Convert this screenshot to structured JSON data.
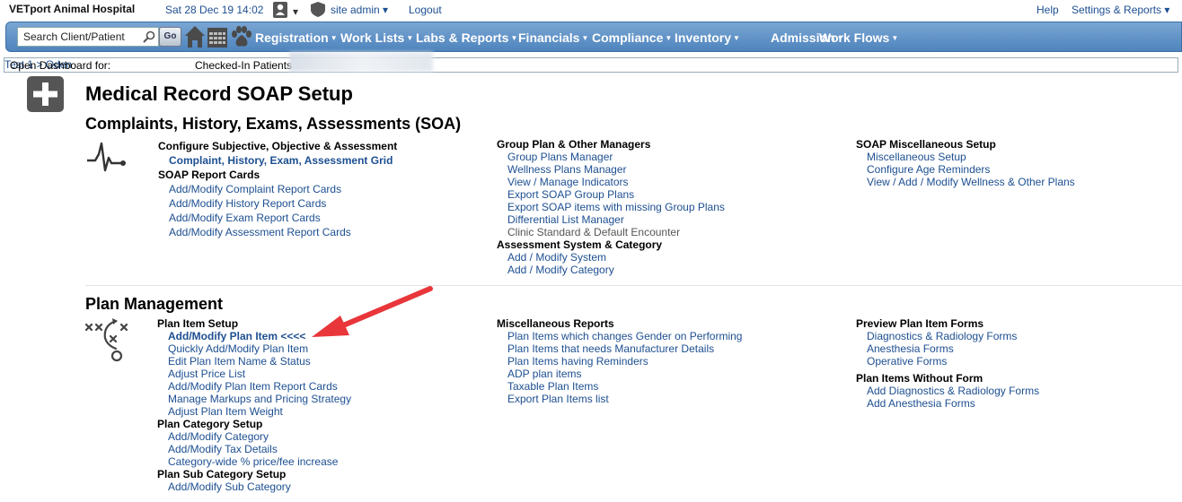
{
  "topbar": {
    "app_title": "VETport Animal Hospital",
    "datetime": "Sat 28 Dec 19 14:02",
    "user_icon": "user-icon",
    "user_caret": "▾",
    "admin_icon": "shield-icon",
    "site_admin": "site admin ▾",
    "logout": "Logout",
    "help": "Help",
    "settings": "Settings & Reports ▾"
  },
  "navbar": {
    "search_placeholder": "Search Client/Patient",
    "go_label": "Go",
    "icons": [
      "home-icon",
      "calendar-icon",
      "paw-icon"
    ],
    "menus": [
      "Registration",
      "Work Lists",
      "Labs & Reports",
      "Financials",
      "Compliance",
      "Inventory",
      "Admission",
      "Work Flows"
    ],
    "caret": "▼"
  },
  "dashbar": {
    "label": "Open Dashboard for:",
    "link": "Test 1 > Oden",
    "checked_in": "Checked-In Patients"
  },
  "page": {
    "title": "Medical Record SOAP Setup",
    "soa_title": "Complaints, History, Exams, Assessments (SOA)",
    "plan_title": "Plan Management"
  },
  "soa": {
    "col1": {
      "h1": "Configure Subjective, Objective & Assessment",
      "l1": "Complaint, History, Exam, Assessment Grid",
      "h2": "SOAP Report Cards",
      "l2": "Add/Modify Complaint Report Cards",
      "l3": "Add/Modify History Report Cards",
      "l4": "Add/Modify Exam Report Cards",
      "l5": "Add/Modify Assessment Report Cards"
    },
    "col2": {
      "h1": "Group Plan & Other Managers",
      "l1": "Group Plans Manager",
      "l2": "Wellness Plans Manager",
      "l3": "View / Manage Indicators",
      "l4": "Export SOAP Group Plans",
      "l5": "Export SOAP items with missing Group Plans",
      "l6": "Differential List Manager",
      "l7": "Clinic Standard & Default Encounter",
      "h2": "Assessment System & Category",
      "l8": "Add / Modify System",
      "l9": "Add / Modify Category"
    },
    "col3": {
      "h1": "SOAP Miscellaneous Setup",
      "l1": "Miscellaneous Setup",
      "l2": "Configure Age Reminders",
      "l3": "View / Add / Modify Wellness & Other Plans"
    }
  },
  "plan": {
    "col1": {
      "h1": "Plan Item Setup",
      "l1": "Add/Modify Plan Item <<<<",
      "l2": "Quickly Add/Modify Plan Item",
      "l3": "Edit Plan Item Name & Status",
      "l4": "Adjust Price List",
      "l5": "Add/Modify Plan Item Report Cards",
      "l6": "Manage Markups and Pricing Strategy",
      "l7": "Adjust Plan Item Weight",
      "h2": "Plan Category Setup",
      "l8": "Add/Modify Category",
      "l9": "Add/Modify Tax Details",
      "l10": "Category-wide % price/fee increase",
      "h3": "Plan Sub Category Setup",
      "l11": "Add/Modify Sub Category"
    },
    "col2": {
      "h1": "Miscellaneous Reports",
      "l1": "Plan Items which changes Gender on Performing",
      "l2": "Plan Items that needs Manufacturer Details",
      "l3": "Plan Items having Reminders",
      "l4": "ADP plan items",
      "l5": "Taxable Plan Items",
      "l6": "Export Plan Items list"
    },
    "col3": {
      "h1": "Preview Plan Item Forms",
      "l1": "Diagnostics & Radiology Forms",
      "l2": "Anesthesia Forms",
      "l3": "Operative Forms",
      "h2": "Plan Items Without Form",
      "l4": "Add Diagnostics & Radiology Forms",
      "l5": "Add Anesthesia Forms"
    }
  },
  "colors": {
    "link": "#1d4f91",
    "nav_bg": "#5a8dc4",
    "arrow": "#e8363a"
  }
}
